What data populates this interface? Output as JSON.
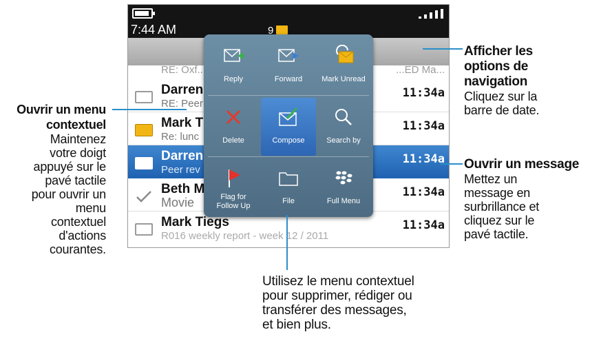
{
  "annotations": {
    "left": {
      "heading_line1": "Ouvrir un menu",
      "heading_line2": "contextuel",
      "body_lines": [
        "Maintenez",
        "votre doigt",
        "appuyé sur le",
        "pavé tactile",
        "pour ouvrir un",
        "menu",
        "contextuel",
        "d'actions",
        "courantes."
      ]
    },
    "right_top": {
      "heading_lines": [
        "Afficher les",
        "options de",
        "navigation"
      ],
      "body_lines": [
        "Cliquez sur la",
        "barre de date."
      ]
    },
    "right_mid": {
      "heading": "Ouvrir un message",
      "body_lines": [
        "Mettez un",
        "message en",
        "surbrillance et",
        "cliquez sur le",
        "pavé tactile."
      ]
    },
    "bottom": {
      "body_lines": [
        "Utilisez le menu contextuel",
        "pour supprimer, rédiger ou",
        "transférer des messages,",
        "et bien plus."
      ]
    }
  },
  "status": {
    "time": "7:44 AM",
    "unread_count": "9"
  },
  "messages": [
    {
      "sender": "",
      "subject": "RE: Oxf...",
      "time": "...ED Ma..."
    },
    {
      "sender": "Darren",
      "subject": "RE: Peer",
      "time": "11:34a"
    },
    {
      "sender": "Mark T",
      "subject": "Re: lunc",
      "time": "11:34a"
    },
    {
      "sender": "Darren",
      "subject": "Peer rev",
      "time": "11:34a"
    },
    {
      "sender": "Beth M",
      "subject": "Movie",
      "time": "11:34a"
    },
    {
      "sender": "Mark Tiegs",
      "subject": "R016 weekly report - week 12 / 2011",
      "time": "11:34a"
    }
  ],
  "menu": {
    "reply": "Reply",
    "forward": "Forward",
    "mark_unread": "Mark Unread",
    "delete": "Delete",
    "compose": "Compose",
    "search_by": "Search by",
    "flag_line1": "Flag for",
    "flag_line2": "Follow Up",
    "file": "File",
    "full_menu": "Full Menu"
  },
  "colors": {
    "annotation_line": "#2a8fc9",
    "selection": "#2d66b4",
    "unread_envelope": "#f2b614",
    "delete_x": "#e23b2e",
    "flag": "#e2322b"
  }
}
